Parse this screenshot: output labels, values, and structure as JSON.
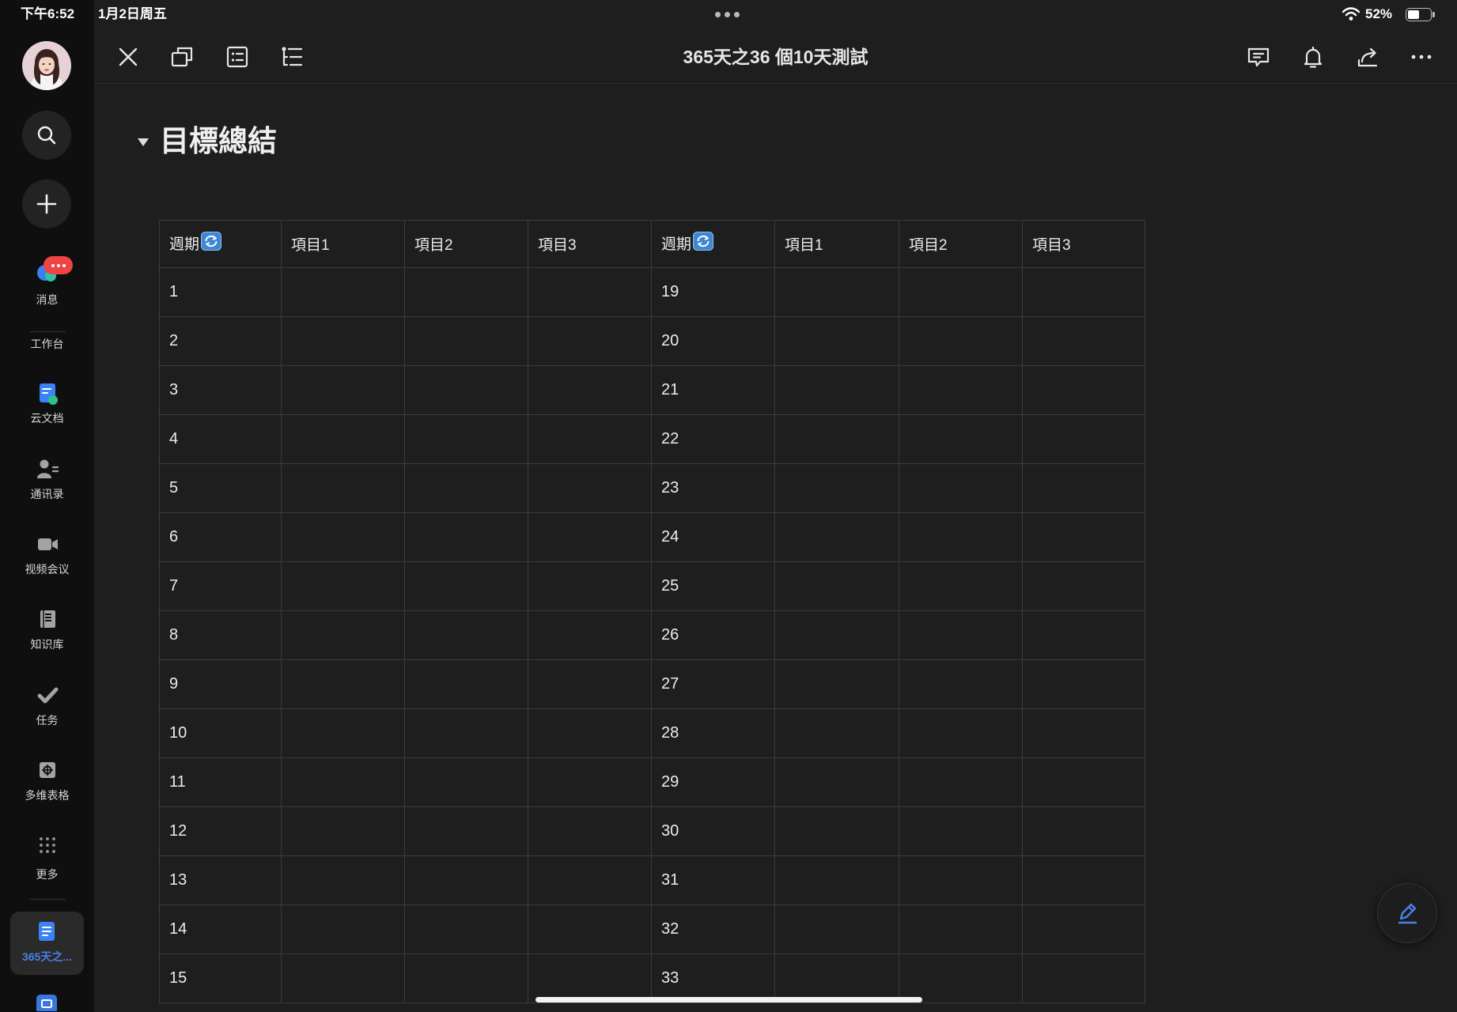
{
  "status_bar": {
    "time": "下午6:52",
    "date": "1月2日周五",
    "battery": "52%",
    "icons": [
      "wifi-icon",
      "battery-icon"
    ]
  },
  "sidebar": {
    "items": [
      {
        "label": "消息",
        "icon": "chat-bubbles-icon"
      },
      {
        "label": "工作台"
      },
      {
        "label": "云文档",
        "icon": "cloud-docs-icon"
      },
      {
        "label": "通讯录",
        "icon": "contacts-icon"
      },
      {
        "label": "视频会议",
        "icon": "video-camera-icon"
      },
      {
        "label": "知识库",
        "icon": "knowledge-base-icon"
      },
      {
        "label": "任务",
        "icon": "task-check-icon"
      },
      {
        "label": "多维表格",
        "icon": "base-table-icon"
      },
      {
        "label": "更多",
        "icon": "more-grid-icon"
      }
    ],
    "open_tabs": [
      {
        "label": "365天之...",
        "icon": "document-icon",
        "active": true
      }
    ]
  },
  "toolbar": {
    "title": "365天之36 個10天測試",
    "left_icons": [
      "close-icon",
      "window-icon",
      "list-icon",
      "outline-icon"
    ],
    "right_icons": [
      "comment-icon",
      "bell-icon",
      "share-icon",
      "more-icon"
    ]
  },
  "doc": {
    "heading": "目標總結",
    "table": {
      "columns": [
        {
          "label": "週期",
          "icon": "repeat-icon"
        },
        {
          "label": "項目1"
        },
        {
          "label": "項目2"
        },
        {
          "label": "項目3"
        },
        {
          "label": "週期",
          "icon": "repeat-icon"
        },
        {
          "label": "項目1"
        },
        {
          "label": "項目2"
        },
        {
          "label": "項目3"
        }
      ],
      "rows": [
        [
          "1",
          "",
          "",
          "",
          "19",
          "",
          "",
          ""
        ],
        [
          "2",
          "",
          "",
          "",
          "20",
          "",
          "",
          ""
        ],
        [
          "3",
          "",
          "",
          "",
          "21",
          "",
          "",
          ""
        ],
        [
          "4",
          "",
          "",
          "",
          "22",
          "",
          "",
          ""
        ],
        [
          "5",
          "",
          "",
          "",
          "23",
          "",
          "",
          ""
        ],
        [
          "6",
          "",
          "",
          "",
          "24",
          "",
          "",
          ""
        ],
        [
          "7",
          "",
          "",
          "",
          "25",
          "",
          "",
          ""
        ],
        [
          "8",
          "",
          "",
          "",
          "26",
          "",
          "",
          ""
        ],
        [
          "9",
          "",
          "",
          "",
          "27",
          "",
          "",
          ""
        ],
        [
          "10",
          "",
          "",
          "",
          "28",
          "",
          "",
          ""
        ],
        [
          "11",
          "",
          "",
          "",
          "29",
          "",
          "",
          ""
        ],
        [
          "12",
          "",
          "",
          "",
          "30",
          "",
          "",
          ""
        ],
        [
          "13",
          "",
          "",
          "",
          "31",
          "",
          "",
          ""
        ],
        [
          "14",
          "",
          "",
          "",
          "32",
          "",
          "",
          ""
        ],
        [
          "15",
          "",
          "",
          "",
          "33",
          "",
          "",
          ""
        ]
      ]
    }
  },
  "colors": {
    "background": "#1e1e1e",
    "sidebar": "#0f0f0f",
    "accent": "#4a7fe6",
    "badge": "#ef4444",
    "table_border": "#3c3c3c"
  }
}
